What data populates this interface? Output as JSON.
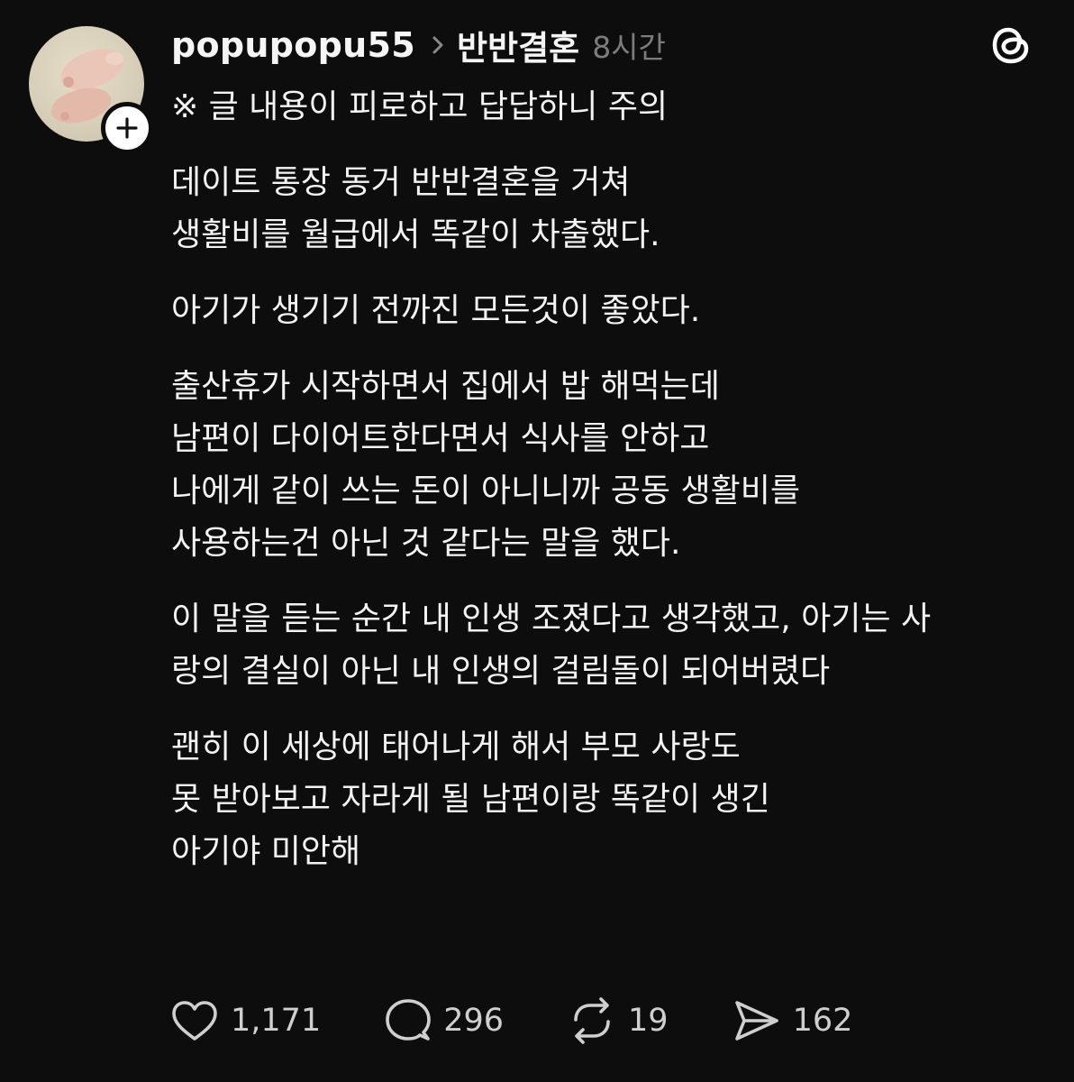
{
  "post": {
    "username": "popupopu55",
    "topic": "반반결혼",
    "time": "8시간",
    "lines": [
      "※ 글 내용이 피로하고 답답하니 주의",
      "데이트 통장 동거 반반결혼을 거쳐",
      "생활비를 월급에서 똑같이 차출했다.",
      "아기가 생기기 전까진 모든것이 좋았다.",
      "출산휴가 시작하면서 집에서 밥 해먹는데",
      "남편이 다이어트한다면서 식사를 안하고",
      "나에게 같이 쓰는 돈이 아니니까 공동 생활비를",
      "사용하는건 아닌 것 같다는 말을 했다.",
      "이 말을 듣는 순간 내 인생 조졌다고 생각했고, 아기는 사",
      "랑의 결실이 아닌 내 인생의 걸림돌이 되어버렸다",
      "괜히 이 세상에 태어나게 해서 부모 사랑도",
      "못 받아보고 자라게 될 남편이랑 똑같이 생긴",
      "아기야 미안해"
    ]
  },
  "actions": {
    "likes": "1,171",
    "comments": "296",
    "reposts": "19",
    "shares": "162"
  },
  "icons": {
    "avatar": "avatar-photo",
    "follow": "plus-icon",
    "chevron": "chevron-right-icon",
    "logo": "threads-logo-icon",
    "like": "heart-icon",
    "comment": "comment-bubble-icon",
    "repost": "repost-icon",
    "share": "send-icon"
  },
  "colors": {
    "background": "#0d0d0d",
    "text": "#f3f3f3",
    "muted": "#7c7c7c"
  }
}
